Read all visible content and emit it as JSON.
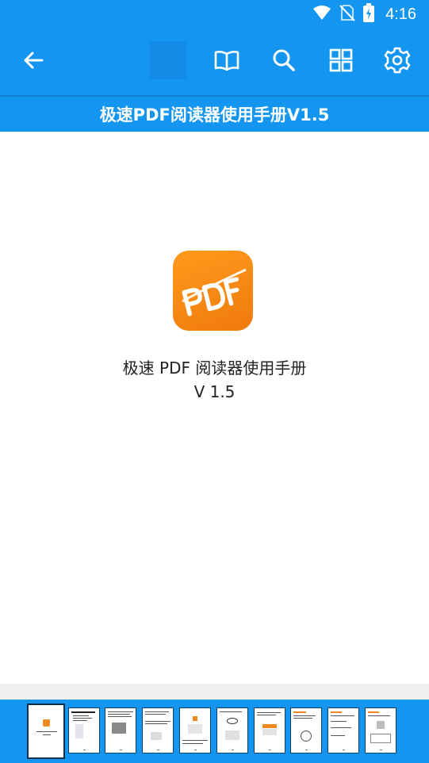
{
  "status_bar": {
    "time": "4:16",
    "icons": [
      "wifi-icon",
      "no-sim-icon",
      "battery-charging-icon"
    ]
  },
  "toolbar": {
    "buttons": [
      "back-arrow-icon",
      "book-icon",
      "search-icon",
      "grid-icon",
      "gear-icon"
    ]
  },
  "document": {
    "title_bar": "极速PDF阅读器使用手册V1.5",
    "cover_title": "极速 PDF 阅读器使用手册",
    "cover_version": "V 1.5",
    "logo_text": "PDF"
  },
  "colors": {
    "primary": "#1496f0",
    "logo_orange": "#f5870f"
  },
  "thumbnails": {
    "current_page": 1,
    "pages": [
      1,
      2,
      3,
      4,
      5,
      6,
      7,
      8,
      9,
      10
    ]
  }
}
